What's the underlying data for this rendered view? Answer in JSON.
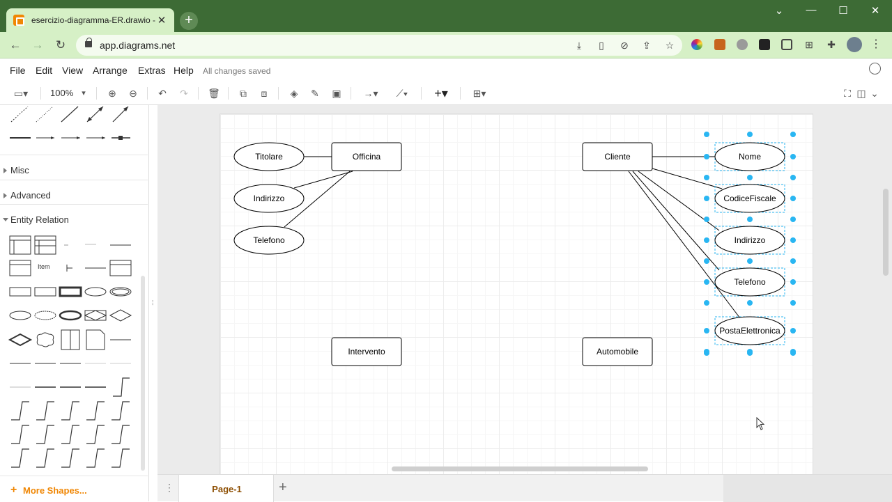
{
  "browser": {
    "tab_title": "esercizio-diagramma-ER.drawio - ",
    "tab_close": "✕",
    "new_tab": "+",
    "url": "app.diagrams.net",
    "window_controls": {
      "minimize": "—",
      "restore": "☐",
      "close": "✕",
      "tabs_dropdown": "⌄"
    }
  },
  "menubar": {
    "items": [
      "File",
      "Edit",
      "View",
      "Arrange",
      "Extras",
      "Help"
    ],
    "status": "All changes saved"
  },
  "toolbar": {
    "zoom": "100%",
    "zoom_caret": "▾"
  },
  "sidebar": {
    "sections": [
      {
        "label": "Misc",
        "open": false
      },
      {
        "label": "Advanced",
        "open": false
      },
      {
        "label": "Entity Relation",
        "open": true
      }
    ],
    "palette_item_text": "Item",
    "more_shapes": "More Shapes..."
  },
  "diagram": {
    "entities": [
      {
        "id": "officina",
        "label": "Officina"
      },
      {
        "id": "cliente",
        "label": "Cliente"
      },
      {
        "id": "intervento",
        "label": "Intervento"
      },
      {
        "id": "automobile",
        "label": "Automobile"
      }
    ],
    "attributes": [
      {
        "id": "titolare",
        "label": "Titolare",
        "entity": "officina"
      },
      {
        "id": "indirizzo-o",
        "label": "Indirizzo",
        "entity": "officina"
      },
      {
        "id": "telefono-o",
        "label": "Telefono",
        "entity": "officina"
      },
      {
        "id": "nome",
        "label": "Nome",
        "entity": "cliente",
        "selected": true
      },
      {
        "id": "codicefiscale",
        "label": "CodiceFiscale",
        "entity": "cliente",
        "selected": true
      },
      {
        "id": "indirizzo-c",
        "label": "Indirizzo",
        "entity": "cliente",
        "selected": true
      },
      {
        "id": "telefono-c",
        "label": "Telefono",
        "entity": "cliente",
        "selected": true
      },
      {
        "id": "postaelettronica",
        "label": "PostaElettronica",
        "entity": "cliente",
        "selected": true
      }
    ],
    "selection_color": "#29b6f2"
  },
  "pages": {
    "tabs": [
      "Page-1"
    ],
    "active": "Page-1",
    "add": "+"
  },
  "colors": {
    "browser_frame": "#3d6b35",
    "tab_active": "#d6f0c6",
    "accent": "#f08705"
  }
}
